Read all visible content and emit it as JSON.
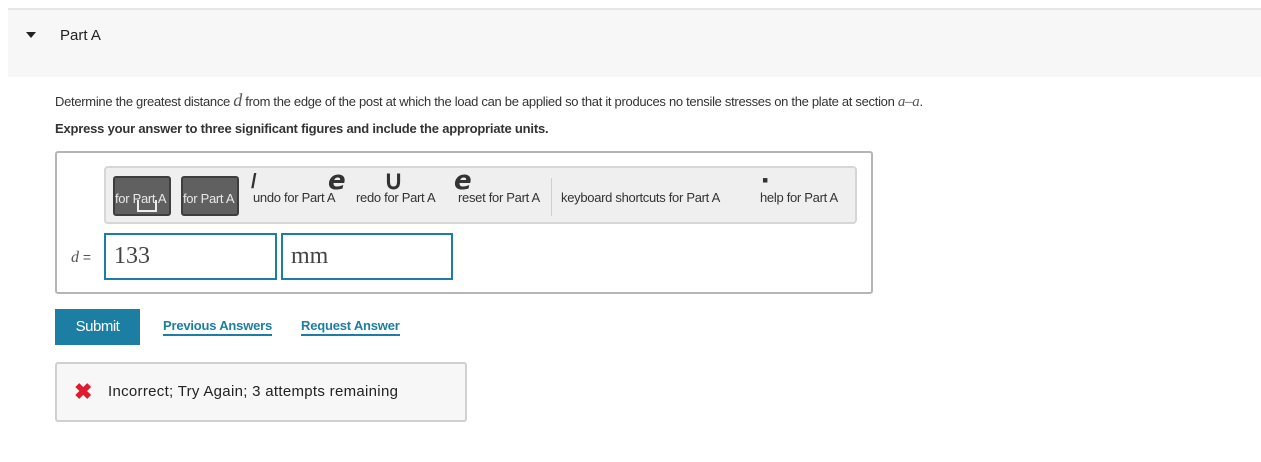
{
  "header": {
    "part_title": "Part A"
  },
  "question": {
    "text_1": "Determine the greatest distance ",
    "var_d": "d",
    "text_2": " from the edge of the post at which the load can be applied so that it produces no tensile stresses on the plate at section ",
    "section": "a–a",
    "text_3": "."
  },
  "instruction": "Express your answer to three significant figures and include the appropriate units.",
  "toolbar": {
    "templates_label": "for Part A",
    "units_label": "for Part A",
    "undo": "undo for Part A",
    "redo": "redo for Part A",
    "reset": "reset for Part A",
    "keyboard": "keyboard shortcuts for Part A",
    "help": "help for Part A"
  },
  "answer": {
    "var_label": "d",
    "equals": "=",
    "value": "133",
    "units": "mm"
  },
  "actions": {
    "submit": "Submit",
    "previous_answers": "Previous Answers",
    "request_answer": "Request Answer"
  },
  "feedback": {
    "message": "Incorrect; Try Again; 3 attempts remaining"
  },
  "colors": {
    "accent": "#1c7ea3",
    "error": "#e01b2f"
  }
}
